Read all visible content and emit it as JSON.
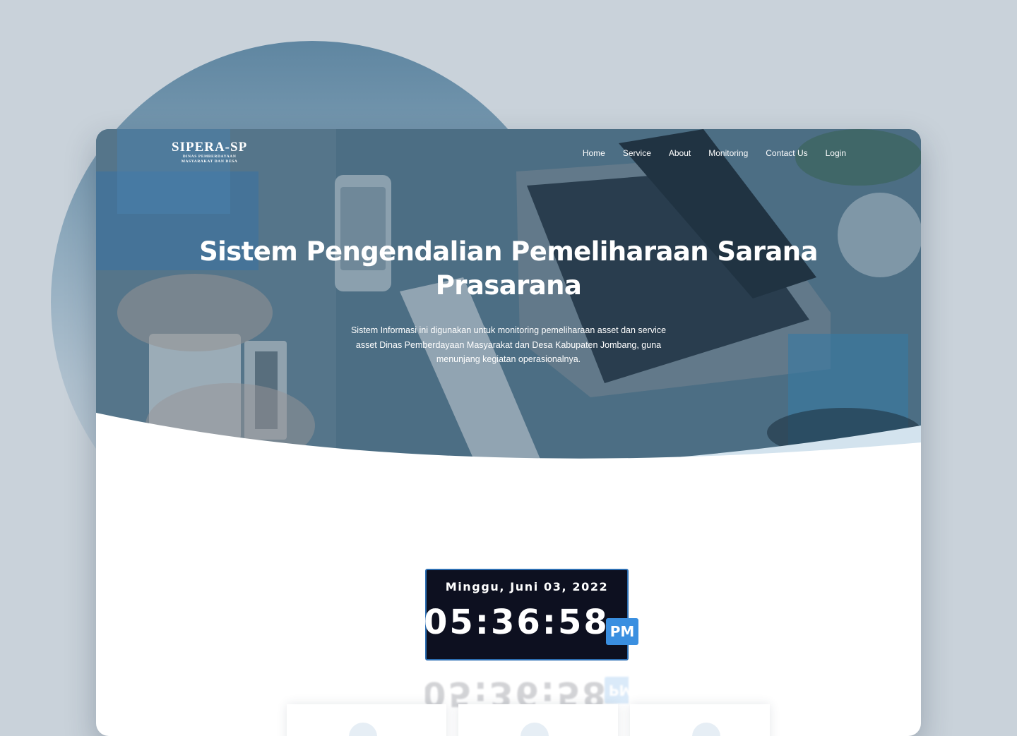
{
  "brand": {
    "title": "SIPERA-SP",
    "subtitle_line1": "DINAS PEMBERDAYAAN",
    "subtitle_line2": "MASYARAKAT DAN DESA"
  },
  "nav": {
    "items": [
      {
        "label": "Home"
      },
      {
        "label": "Service"
      },
      {
        "label": "About"
      },
      {
        "label": "Monitoring"
      },
      {
        "label": "Contact Us"
      },
      {
        "label": "Login"
      }
    ]
  },
  "hero": {
    "title_line1": "Sistem Pengendalian Pemeliharaan Sarana",
    "title_line2": "Prasarana",
    "description_line1": "Sistem Informasi ini digunakan untuk monitoring pemeliharaan asset dan service",
    "description_line2": "asset Dinas Pemberdayaan Masyarakat dan Desa Kabupaten Jombang, guna",
    "description_line3": "menunjang kegiatan operasionalnya."
  },
  "clock": {
    "date": "Minggu, Juni 03, 2022",
    "time": "05:36:58",
    "ampm": "PM"
  },
  "colors": {
    "page_background": "#c9d2da",
    "clock_background": "#0d1020",
    "clock_border": "#2d6fb3",
    "ampm_badge": "#3a8fe0",
    "hero_overlay": "#3f6478",
    "wave_accent": "#d3e3ee"
  }
}
